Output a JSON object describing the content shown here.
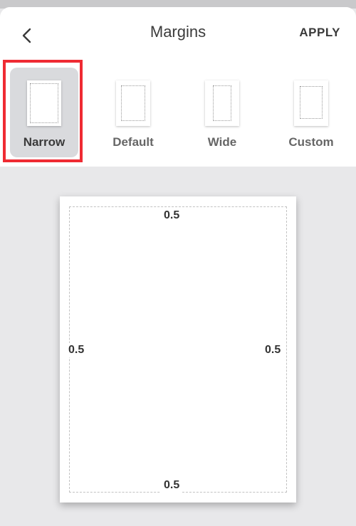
{
  "header": {
    "title": "Margins",
    "apply_label": "APPLY"
  },
  "options": [
    {
      "label": "Narrow",
      "selected": true
    },
    {
      "label": "Default",
      "selected": false
    },
    {
      "label": "Wide",
      "selected": false
    },
    {
      "label": "Custom",
      "selected": false
    }
  ],
  "preview": {
    "top": "0.5",
    "bottom": "0.5",
    "left": "0.5",
    "right": "0.5"
  },
  "colors": {
    "highlight": "#ef2b33",
    "selected_bg": "#d9dadd",
    "background": "#e8e8ea"
  },
  "icons": {
    "back": "chevron-left-icon"
  }
}
